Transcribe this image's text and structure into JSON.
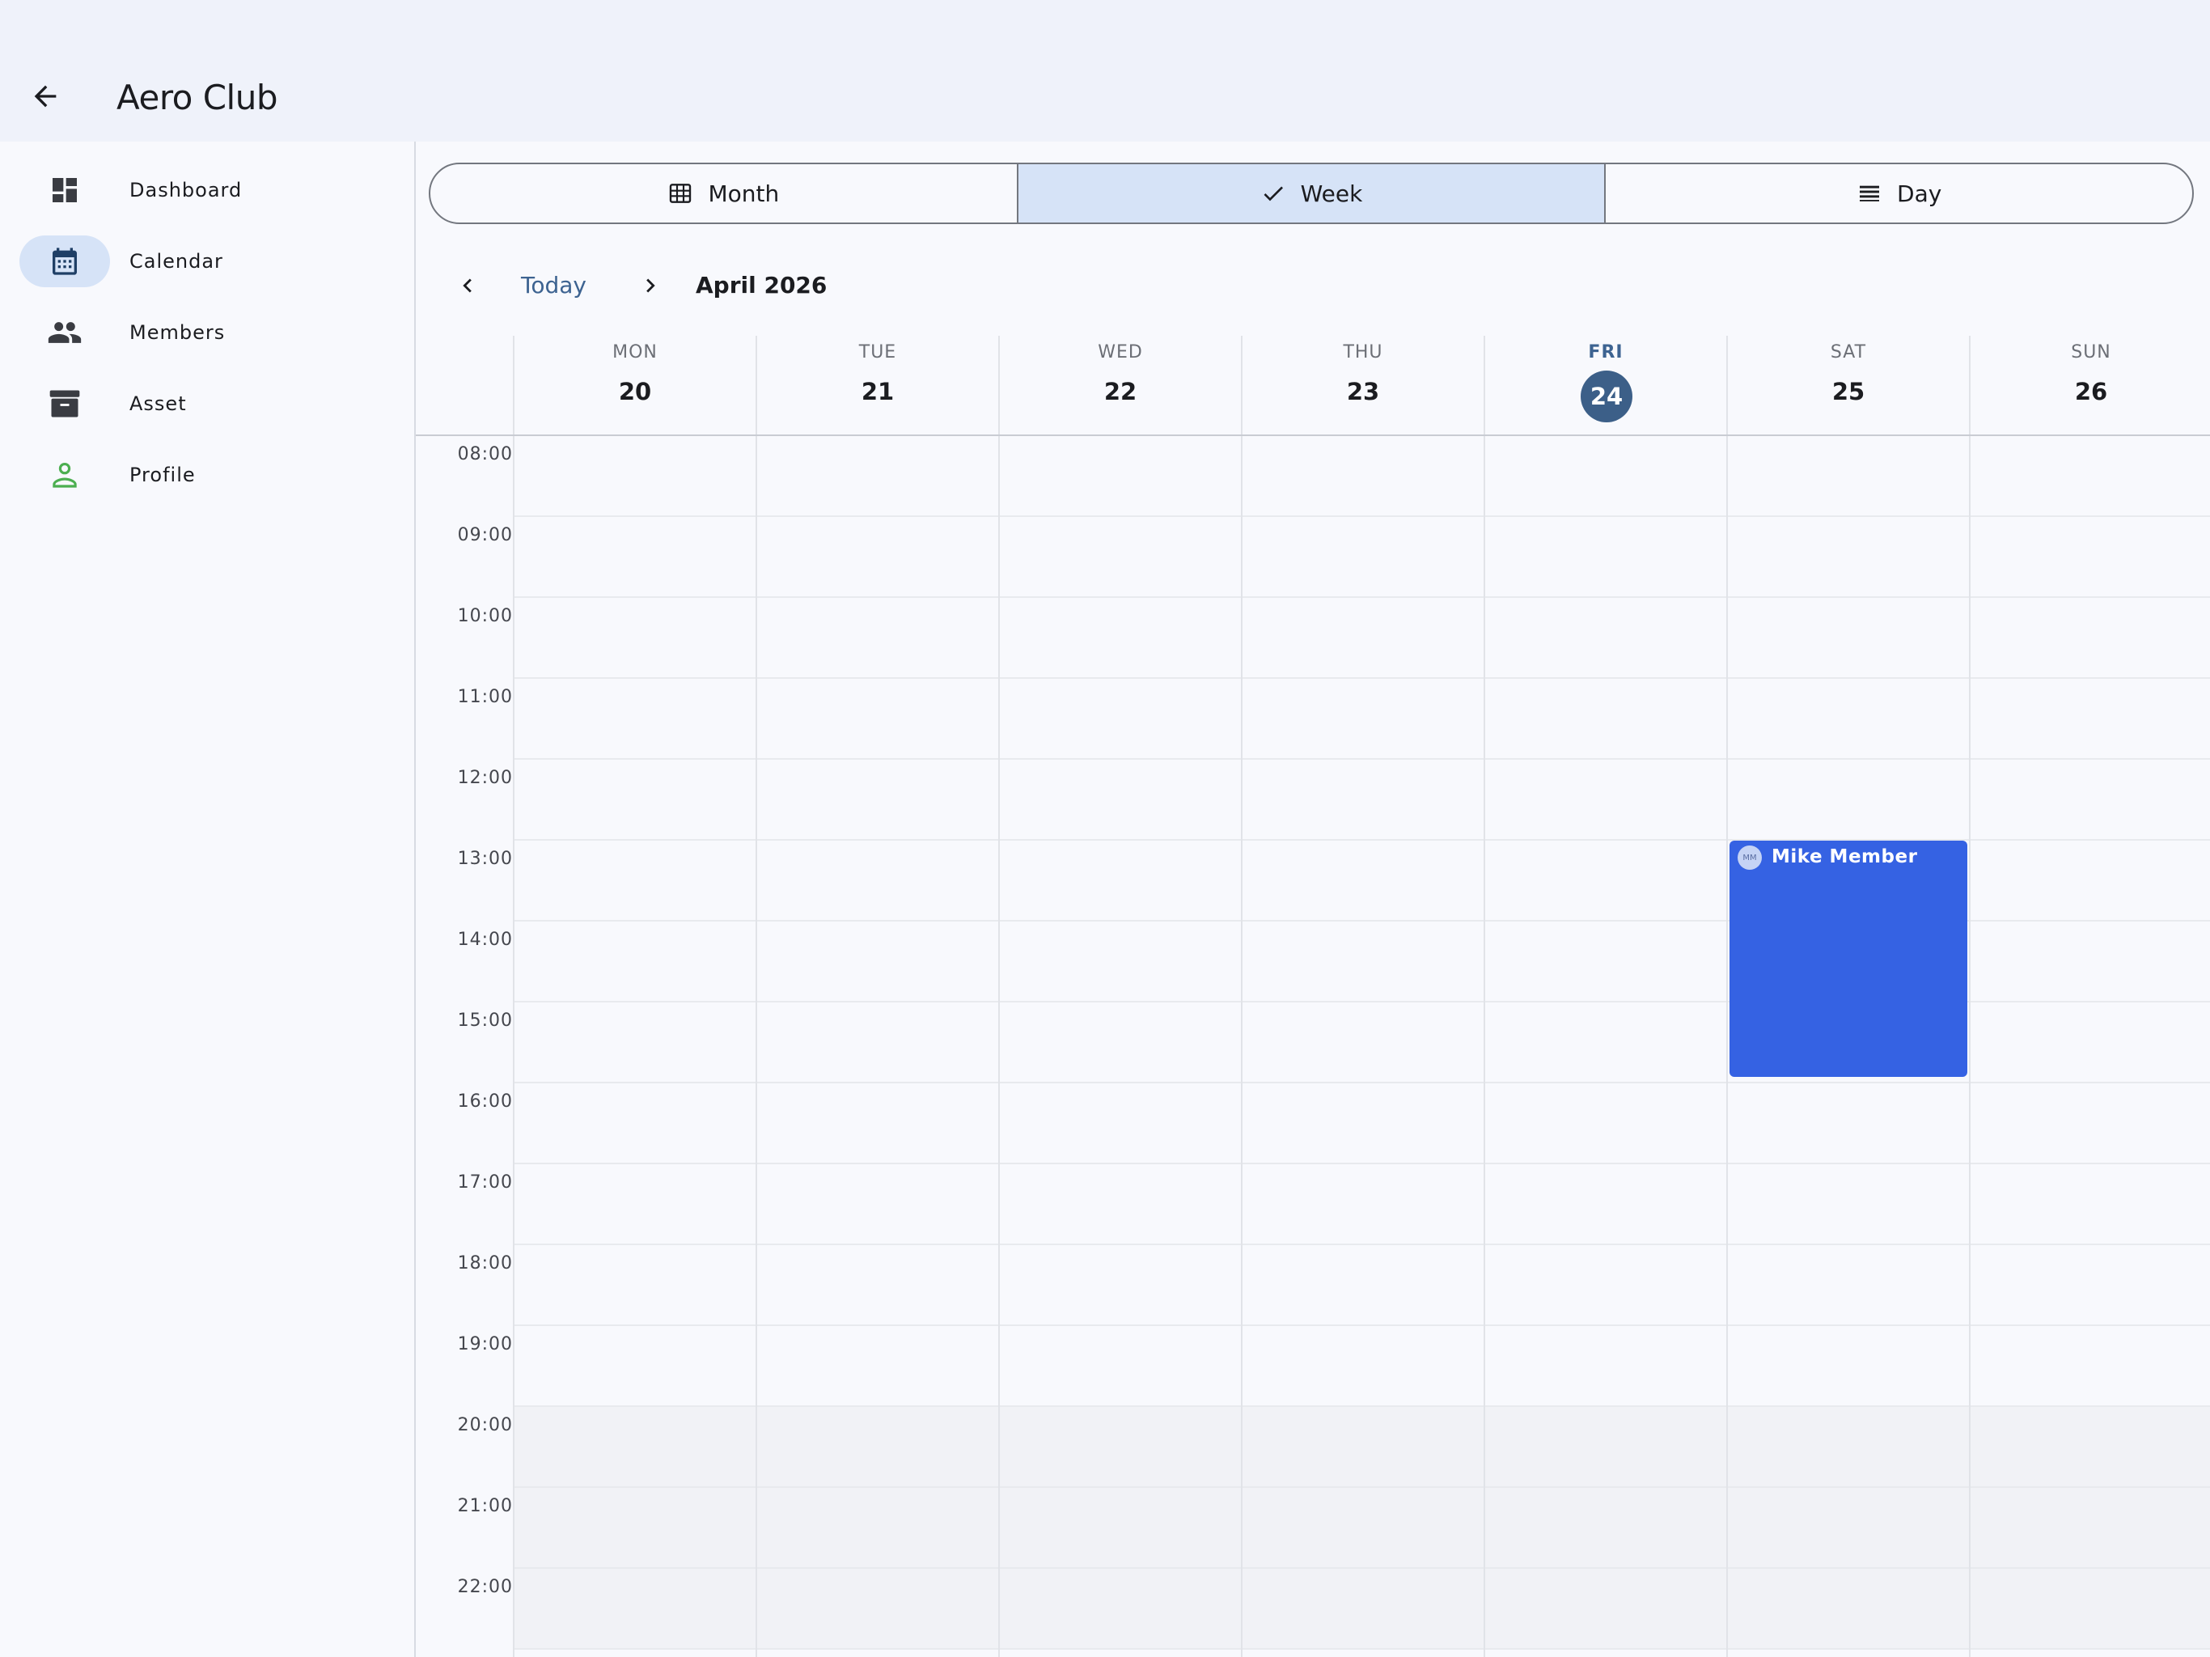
{
  "app": {
    "title": "Aero Club"
  },
  "sidebar": {
    "items": [
      {
        "label": "Dashboard",
        "icon": "dashboard-icon"
      },
      {
        "label": "Calendar",
        "icon": "calendar-icon"
      },
      {
        "label": "Members",
        "icon": "people-icon"
      },
      {
        "label": "Asset",
        "icon": "archive-icon"
      },
      {
        "label": "Profile",
        "icon": "person-icon"
      }
    ],
    "active": "Calendar"
  },
  "view_switcher": {
    "options": [
      {
        "label": "Month",
        "icon": "grid-icon"
      },
      {
        "label": "Week",
        "icon": "check-icon"
      },
      {
        "label": "Day",
        "icon": "list-icon"
      }
    ],
    "selected": "Week"
  },
  "navigation": {
    "today_label": "Today",
    "period": "April 2026"
  },
  "week": {
    "days": [
      {
        "dow": "MON",
        "date": "20"
      },
      {
        "dow": "TUE",
        "date": "21"
      },
      {
        "dow": "WED",
        "date": "22"
      },
      {
        "dow": "THU",
        "date": "23"
      },
      {
        "dow": "FRI",
        "date": "24",
        "today": true
      },
      {
        "dow": "SAT",
        "date": "25"
      },
      {
        "dow": "SUN",
        "date": "26"
      }
    ],
    "hours": [
      "08:00",
      "09:00",
      "10:00",
      "11:00",
      "12:00",
      "13:00",
      "14:00",
      "15:00",
      "16:00",
      "17:00",
      "18:00",
      "19:00",
      "20:00",
      "21:00",
      "22:00"
    ]
  },
  "events": [
    {
      "title": "Mike Member",
      "initials": "MM",
      "day": "SAT",
      "start": "13:00",
      "end": "16:00"
    }
  ],
  "colors": {
    "accent": "#3d6391",
    "selected_bg": "#d6e3f7",
    "event": "#3562e3",
    "today_circle": "#3c5f88",
    "profile_icon": "#4caf50"
  }
}
